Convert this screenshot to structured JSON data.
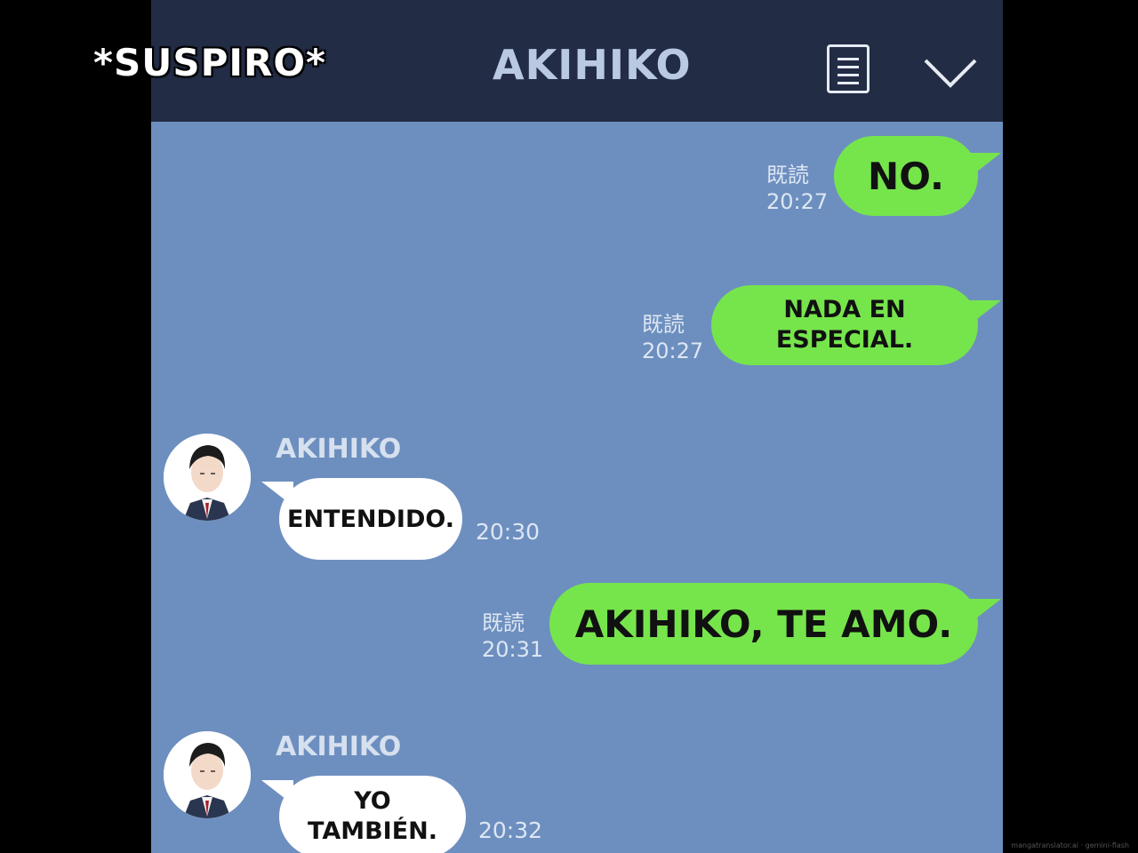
{
  "overlay": {
    "sigh_text": "*SUSPIRO*"
  },
  "header": {
    "title": "AKIHIKO",
    "menu_icon": "list-icon",
    "collapse_icon": "chevron-down-icon"
  },
  "messages": [
    {
      "type": "sent",
      "text": "NO.",
      "read": "既読",
      "time": "20:27"
    },
    {
      "type": "sent",
      "text": "NADA EN ESPECIAL.",
      "read": "既読",
      "time": "20:27"
    },
    {
      "type": "received",
      "sender": "AKIHIKO",
      "text": "ENTENDIDO.",
      "time": "20:30"
    },
    {
      "type": "sent",
      "text": "AKIHIKO, TE AMO.",
      "read": "既読",
      "time": "20:31"
    },
    {
      "type": "received",
      "sender": "AKIHIKO",
      "text": "YO TAMBIÉN.",
      "time": "20:32"
    }
  ],
  "watermark": "mangatranslator.ai · gemini-flash",
  "colors": {
    "header_bg": "#222c44",
    "chat_bg": "#6d8fbf",
    "sent_bubble": "#76e54c",
    "received_bubble": "#ffffff"
  }
}
